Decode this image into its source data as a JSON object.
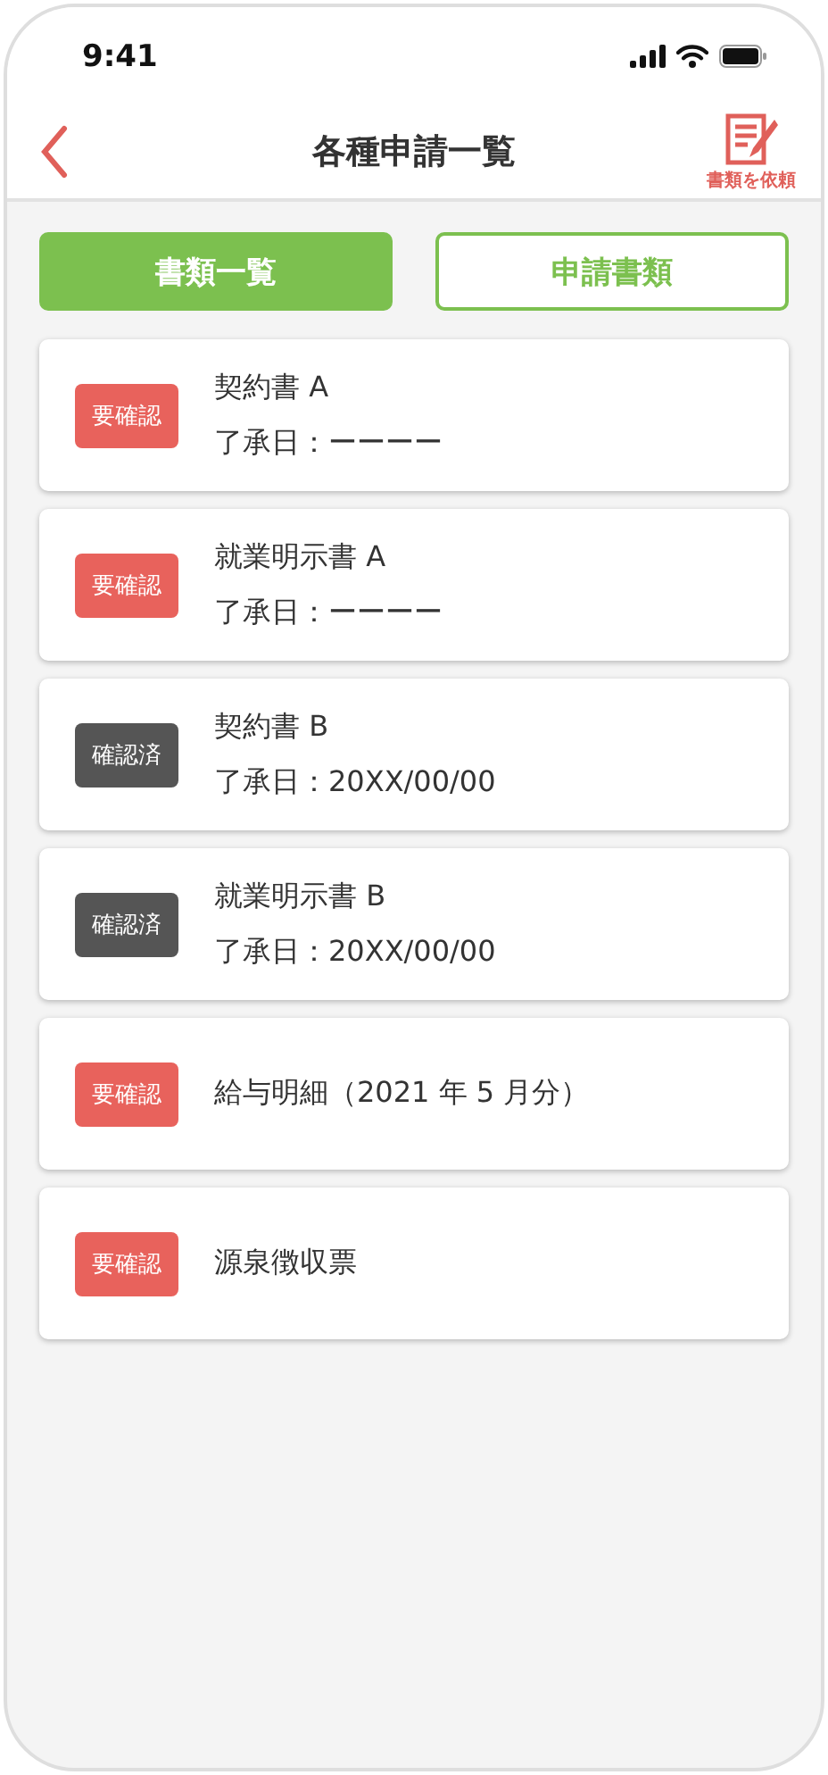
{
  "status_bar": {
    "time": "9:41"
  },
  "header": {
    "title": "各種申請一覧",
    "action_label": "書類を依頼"
  },
  "tabs": [
    {
      "label": "書類一覧",
      "selected": true
    },
    {
      "label": "申請書類",
      "selected": false
    }
  ],
  "documents": [
    {
      "badge": "要確認",
      "kind": "pending",
      "title": "契約書 A",
      "approval": "了承日：ーーーー"
    },
    {
      "badge": "要確認",
      "kind": "pending",
      "title": "就業明示書 A",
      "approval": "了承日：ーーーー"
    },
    {
      "badge": "確認済",
      "kind": "done",
      "title": "契約書 B",
      "approval": "了承日：20XX/00/00"
    },
    {
      "badge": "確認済",
      "kind": "done",
      "title": "就業明示書 B",
      "approval": "了承日：20XX/00/00"
    },
    {
      "badge": "要確認",
      "kind": "pending",
      "title": "給与明細（2021 年 5 月分）"
    },
    {
      "badge": "要確認",
      "kind": "pending",
      "title": "源泉徴収票"
    }
  ]
}
